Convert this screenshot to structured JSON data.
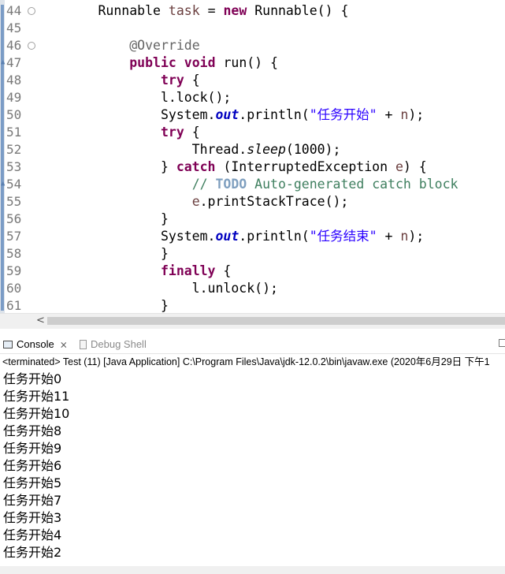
{
  "editor": {
    "line_numbers": [
      "44",
      "45",
      "46",
      "47",
      "48",
      "49",
      "50",
      "51",
      "52",
      "53",
      "54",
      "55",
      "56",
      "57",
      "58",
      "59",
      "60",
      "61"
    ],
    "code_lines": [
      [
        {
          "t": "        Runnable ",
          "c": ""
        },
        {
          "t": "task",
          "c": "var"
        },
        {
          "t": " = ",
          "c": ""
        },
        {
          "t": "new",
          "c": "kw"
        },
        {
          "t": " Runnable() {",
          "c": ""
        }
      ],
      [
        {
          "t": "",
          "c": ""
        }
      ],
      [
        {
          "t": "            ",
          "c": ""
        },
        {
          "t": "@Override",
          "c": "ann"
        }
      ],
      [
        {
          "t": "            ",
          "c": ""
        },
        {
          "t": "public",
          "c": "kw"
        },
        {
          "t": " ",
          "c": ""
        },
        {
          "t": "void",
          "c": "kw"
        },
        {
          "t": " run() {",
          "c": ""
        }
      ],
      [
        {
          "t": "                ",
          "c": ""
        },
        {
          "t": "try",
          "c": "kw"
        },
        {
          "t": " {",
          "c": ""
        }
      ],
      [
        {
          "t": "                l.lock();",
          "c": ""
        }
      ],
      [
        {
          "t": "                System.",
          "c": ""
        },
        {
          "t": "out",
          "c": "fld"
        },
        {
          "t": ".println(",
          "c": ""
        },
        {
          "t": "\"任务开始\"",
          "c": "str"
        },
        {
          "t": " + ",
          "c": ""
        },
        {
          "t": "n",
          "c": "var"
        },
        {
          "t": ");",
          "c": ""
        }
      ],
      [
        {
          "t": "                ",
          "c": ""
        },
        {
          "t": "try",
          "c": "kw"
        },
        {
          "t": " {",
          "c": ""
        }
      ],
      [
        {
          "t": "                    Thread.",
          "c": ""
        },
        {
          "t": "sleep",
          "c": "it"
        },
        {
          "t": "(1000);",
          "c": ""
        }
      ],
      [
        {
          "t": "                } ",
          "c": ""
        },
        {
          "t": "catch",
          "c": "kw"
        },
        {
          "t": " (InterruptedException ",
          "c": ""
        },
        {
          "t": "e",
          "c": "var"
        },
        {
          "t": ") {",
          "c": ""
        }
      ],
      [
        {
          "t": "                    ",
          "c": ""
        },
        {
          "t": "// ",
          "c": "cmt"
        },
        {
          "t": "TODO",
          "c": "todo"
        },
        {
          "t": " Auto-generated catch block",
          "c": "cmt"
        }
      ],
      [
        {
          "t": "                    ",
          "c": ""
        },
        {
          "t": "e",
          "c": "var"
        },
        {
          "t": ".printStackTrace();",
          "c": ""
        }
      ],
      [
        {
          "t": "                }",
          "c": ""
        }
      ],
      [
        {
          "t": "                System.",
          "c": ""
        },
        {
          "t": "out",
          "c": "fld"
        },
        {
          "t": ".println(",
          "c": ""
        },
        {
          "t": "\"任务结束\"",
          "c": "str"
        },
        {
          "t": " + ",
          "c": ""
        },
        {
          "t": "n",
          "c": "var"
        },
        {
          "t": ");",
          "c": ""
        }
      ],
      [
        {
          "t": "                }",
          "c": ""
        }
      ],
      [
        {
          "t": "                ",
          "c": ""
        },
        {
          "t": "finally",
          "c": "kw"
        },
        {
          "t": " {",
          "c": ""
        }
      ],
      [
        {
          "t": "                    l.unlock();",
          "c": ""
        }
      ],
      [
        {
          "t": "                }",
          "c": ""
        }
      ]
    ]
  },
  "tabs": {
    "console_label": "Console",
    "debug_shell_label": "Debug Shell",
    "close_glyph": "⨯"
  },
  "console": {
    "status": "<terminated> Test (11) [Java Application] C:\\Program Files\\Java\\jdk-12.0.2\\bin\\javaw.exe (2020年6月29日 下午1",
    "output_lines": [
      "任务开始0",
      "任务开始11",
      "任务开始10",
      "任务开始8",
      "任务开始9",
      "任务开始6",
      "任务开始5",
      "任务开始7",
      "任务开始3",
      "任务开始4",
      "任务开始2"
    ]
  },
  "scrollbar": {
    "left_arrow": "<"
  }
}
